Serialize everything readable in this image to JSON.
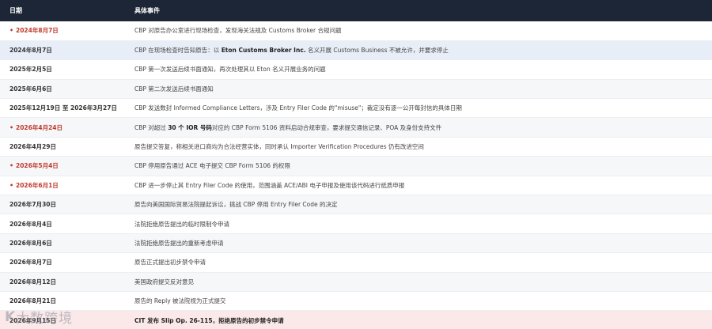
{
  "header": {
    "date": "日期",
    "event": "具体事件"
  },
  "rows": [
    {
      "mark": "•",
      "date": "2024年8月7日",
      "red": true,
      "bg": "",
      "pre": "CBP 对原告办公室进行现场检查，发现海关法规及 Customs Broker 合规问题",
      "bold": "",
      "post": ""
    },
    {
      "mark": "",
      "date": "2024年8月7日",
      "red": false,
      "bg": "hl-blue",
      "pre": "CBP 在现场检查时告知原告：以 ",
      "bold": "Eton Customs Broker Inc.",
      "post": " 名义开展 Customs Business 不被允许，并要求停止"
    },
    {
      "mark": "",
      "date": "2025年2月5日",
      "red": false,
      "bg": "",
      "pre": "CBP 第一次发送后续书面通知，再次处理其以 Eton 名义开展业务的问题",
      "bold": "",
      "post": ""
    },
    {
      "mark": "",
      "date": "2025年6月6日",
      "red": false,
      "bg": "alt",
      "pre": "CBP 第二次发送后续书面通知",
      "bold": "",
      "post": ""
    },
    {
      "mark": "",
      "date": "2025年12月19日 至 2026年3月27日",
      "red": false,
      "bg": "",
      "pre": "CBP 发送数封 Informed Compliance Letters，涉及 Entry Filer Code 的\"misuse\"；裁定没有逐一公开每封信的具体日期",
      "bold": "",
      "post": ""
    },
    {
      "mark": "•",
      "date": "2026年4月24日",
      "red": true,
      "bg": "alt",
      "pre": "CBP 对超过 ",
      "bold": "30 个 IOR 号码",
      "post": "对应的 CBP Form 5106 资料启动合规审查，要求提交通信记录、POA 及身份支持文件"
    },
    {
      "mark": "",
      "date": "2026年4月29日",
      "red": false,
      "bg": "",
      "pre": "原告提交答复，称相关进口商均为合法经营实体，同时承认 Importer Verification Procedures 仍有改进空间",
      "bold": "",
      "post": ""
    },
    {
      "mark": "•",
      "date": "2026年5月4日",
      "red": true,
      "bg": "alt",
      "pre": "CBP 停用原告通过 ACE 电子提交 CBP Form 5106 的权限",
      "bold": "",
      "post": ""
    },
    {
      "mark": "•",
      "date": "2026年6月1日",
      "red": true,
      "bg": "",
      "pre": "CBP 进一步停止其 Entry Filer Code 的使用，范围涵盖 ACE/ABI 电子申报及使用该代码进行纸质申报",
      "bold": "",
      "post": ""
    },
    {
      "mark": "",
      "date": "2026年7月30日",
      "red": false,
      "bg": "alt",
      "pre": "原告向美国国际贸易法院提起诉讼，挑战 CBP 停用 Entry Filer Code 的决定",
      "bold": "",
      "post": ""
    },
    {
      "mark": "",
      "date": "2026年8月4日",
      "red": false,
      "bg": "",
      "pre": "法院拒绝原告提出的临时限制令申请",
      "bold": "",
      "post": ""
    },
    {
      "mark": "",
      "date": "2026年8月6日",
      "red": false,
      "bg": "alt",
      "pre": "法院拒绝原告提出的重新考虑申请",
      "bold": "",
      "post": ""
    },
    {
      "mark": "",
      "date": "2026年8月7日",
      "red": false,
      "bg": "",
      "pre": "原告正式提出初步禁令申请",
      "bold": "",
      "post": ""
    },
    {
      "mark": "",
      "date": "2026年8月12日",
      "red": false,
      "bg": "alt",
      "pre": "美国政府提交反对意见",
      "bold": "",
      "post": ""
    },
    {
      "mark": "",
      "date": "2026年8月21日",
      "red": false,
      "bg": "",
      "pre": "原告的 Reply 被法院视为正式提交",
      "bold": "",
      "post": ""
    },
    {
      "mark": "",
      "date": "2026年9月15日",
      "red": false,
      "bg": "hl-pink",
      "pre": "",
      "bold": "CIT 发布 Slip Op. 26-115，拒绝原告的初步禁令申请",
      "post": ""
    }
  ],
  "watermark": {
    "mark": "K",
    "text": "大数跨境"
  }
}
